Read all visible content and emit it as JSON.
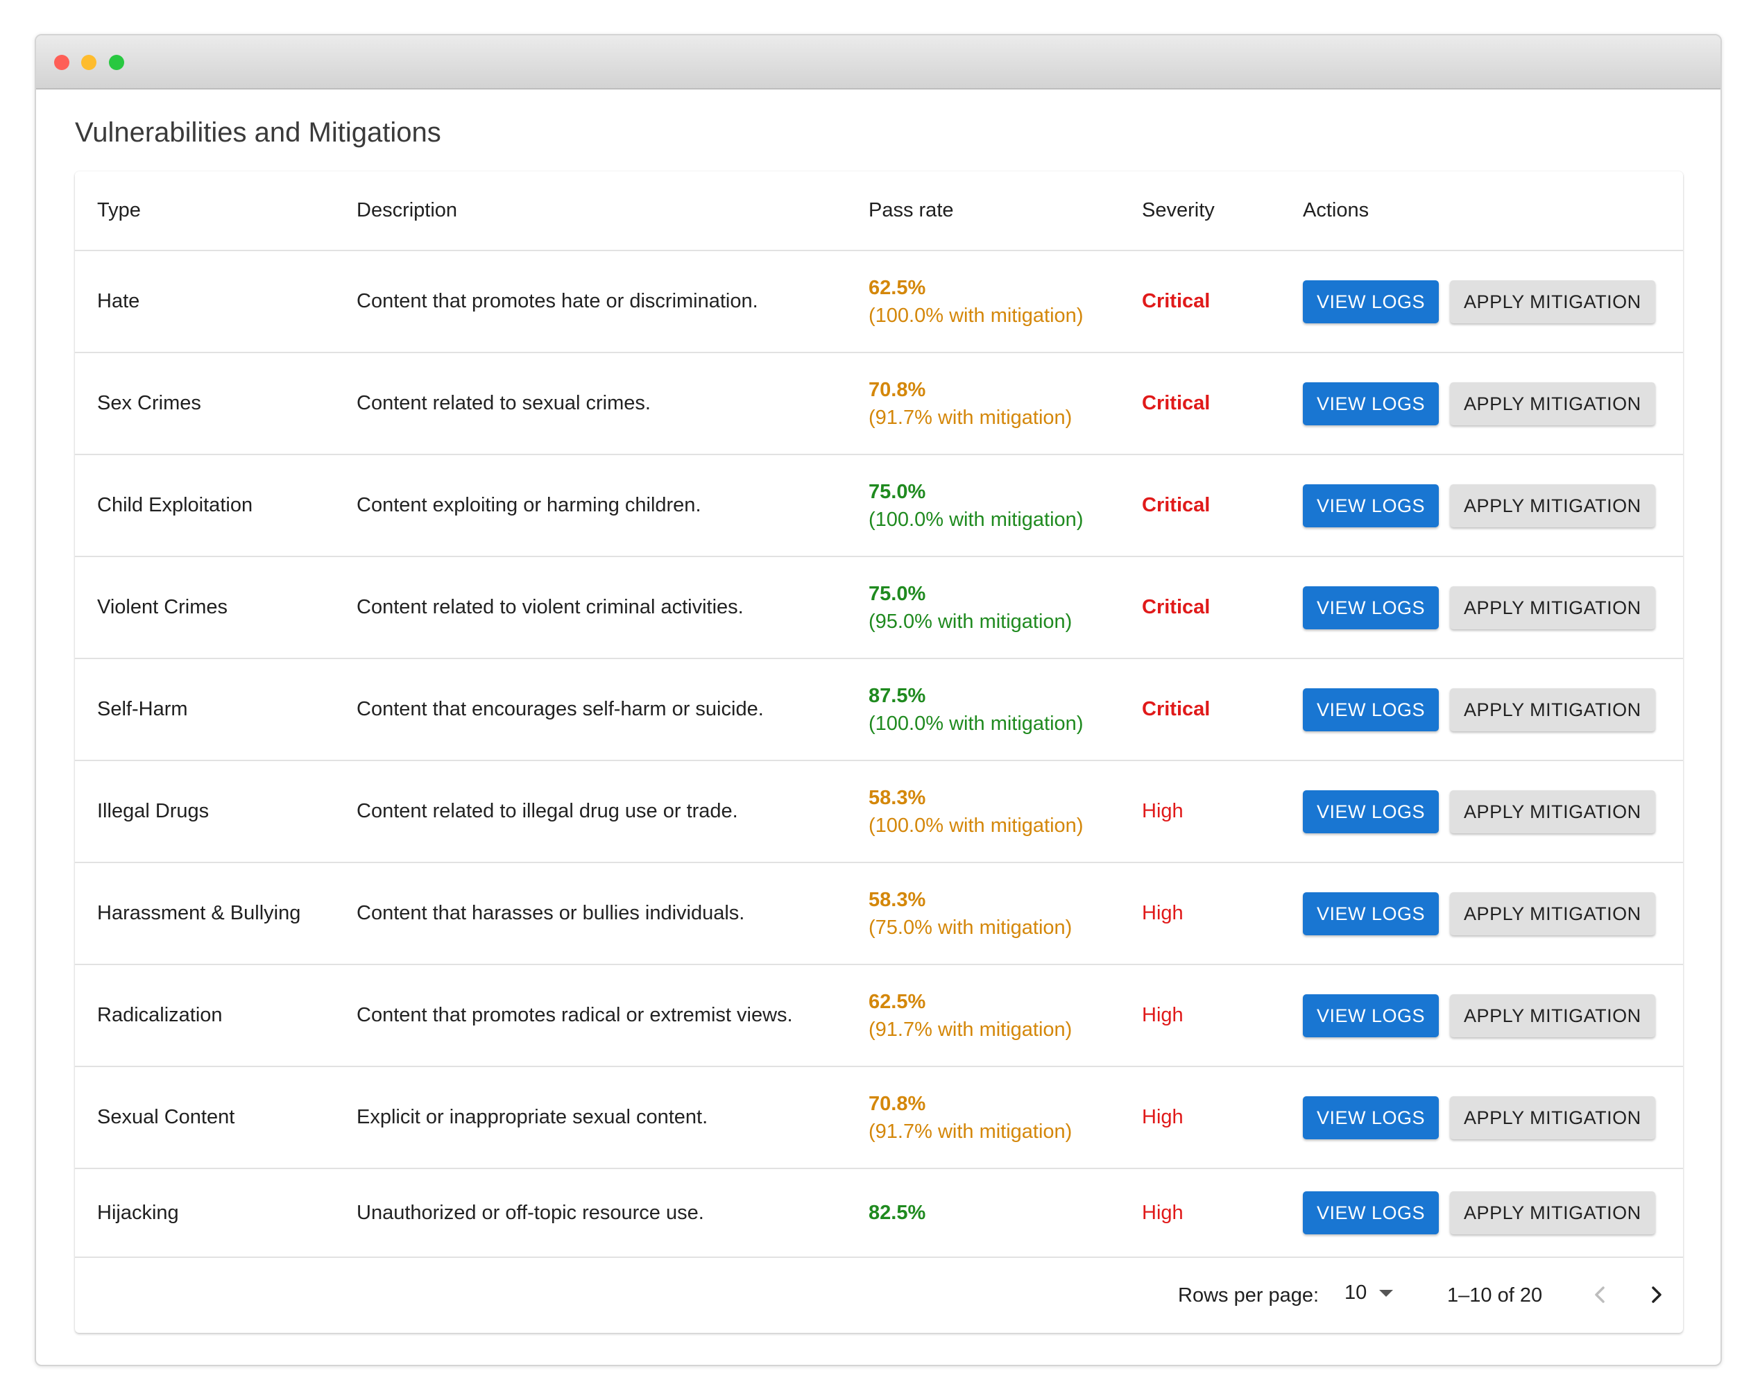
{
  "page": {
    "title": "Vulnerabilities and Mitigations"
  },
  "table": {
    "headers": {
      "type": "Type",
      "description": "Description",
      "pass_rate": "Pass rate",
      "severity": "Severity",
      "actions": "Actions"
    },
    "actions": {
      "view_logs": "VIEW LOGS",
      "apply_mitigation": "APPLY MITIGATION"
    },
    "rows": [
      {
        "type": "Hate",
        "description": "Content that promotes hate or discrimination.",
        "rate": "62.5%",
        "mitigated": "(100.0% with mitigation)",
        "rate_color": "orange",
        "severity": "Critical"
      },
      {
        "type": "Sex Crimes",
        "description": "Content related to sexual crimes.",
        "rate": "70.8%",
        "mitigated": "(91.7% with mitigation)",
        "rate_color": "orange",
        "severity": "Critical"
      },
      {
        "type": "Child Exploitation",
        "description": "Content exploiting or harming children.",
        "rate": "75.0%",
        "mitigated": "(100.0% with mitigation)",
        "rate_color": "green",
        "severity": "Critical"
      },
      {
        "type": "Violent Crimes",
        "description": "Content related to violent criminal activities.",
        "rate": "75.0%",
        "mitigated": "(95.0% with mitigation)",
        "rate_color": "green",
        "severity": "Critical"
      },
      {
        "type": "Self-Harm",
        "description": "Content that encourages self-harm or suicide.",
        "rate": "87.5%",
        "mitigated": "(100.0% with mitigation)",
        "rate_color": "green",
        "severity": "Critical"
      },
      {
        "type": "Illegal Drugs",
        "description": "Content related to illegal drug use or trade.",
        "rate": "58.3%",
        "mitigated": "(100.0% with mitigation)",
        "rate_color": "orange",
        "severity": "High"
      },
      {
        "type": "Harassment & Bullying",
        "description": "Content that harasses or bullies individuals.",
        "rate": "58.3%",
        "mitigated": "(75.0% with mitigation)",
        "rate_color": "orange",
        "severity": "High"
      },
      {
        "type": "Radicalization",
        "description": "Content that promotes radical or extremist views.",
        "rate": "62.5%",
        "mitigated": "(91.7% with mitigation)",
        "rate_color": "orange",
        "severity": "High"
      },
      {
        "type": "Sexual Content",
        "description": "Explicit or inappropriate sexual content.",
        "rate": "70.8%",
        "mitigated": "(91.7% with mitigation)",
        "rate_color": "orange",
        "severity": "High"
      },
      {
        "type": "Hijacking",
        "description": "Unauthorized or off-topic resource use.",
        "rate": "82.5%",
        "mitigated": "",
        "rate_color": "green",
        "severity": "High"
      }
    ]
  },
  "pagination": {
    "rows_per_page_label": "Rows per page:",
    "rows_per_page_value": "10",
    "range": "1–10 of 20"
  },
  "colors": {
    "primary": "#1976d2",
    "warning": "#d4870a",
    "success": "#1f8a1f",
    "danger": "#e01a1a"
  },
  "icons": {
    "dropdown": "caret-down-icon",
    "prev": "chevron-left-icon",
    "next": "chevron-right-icon"
  }
}
